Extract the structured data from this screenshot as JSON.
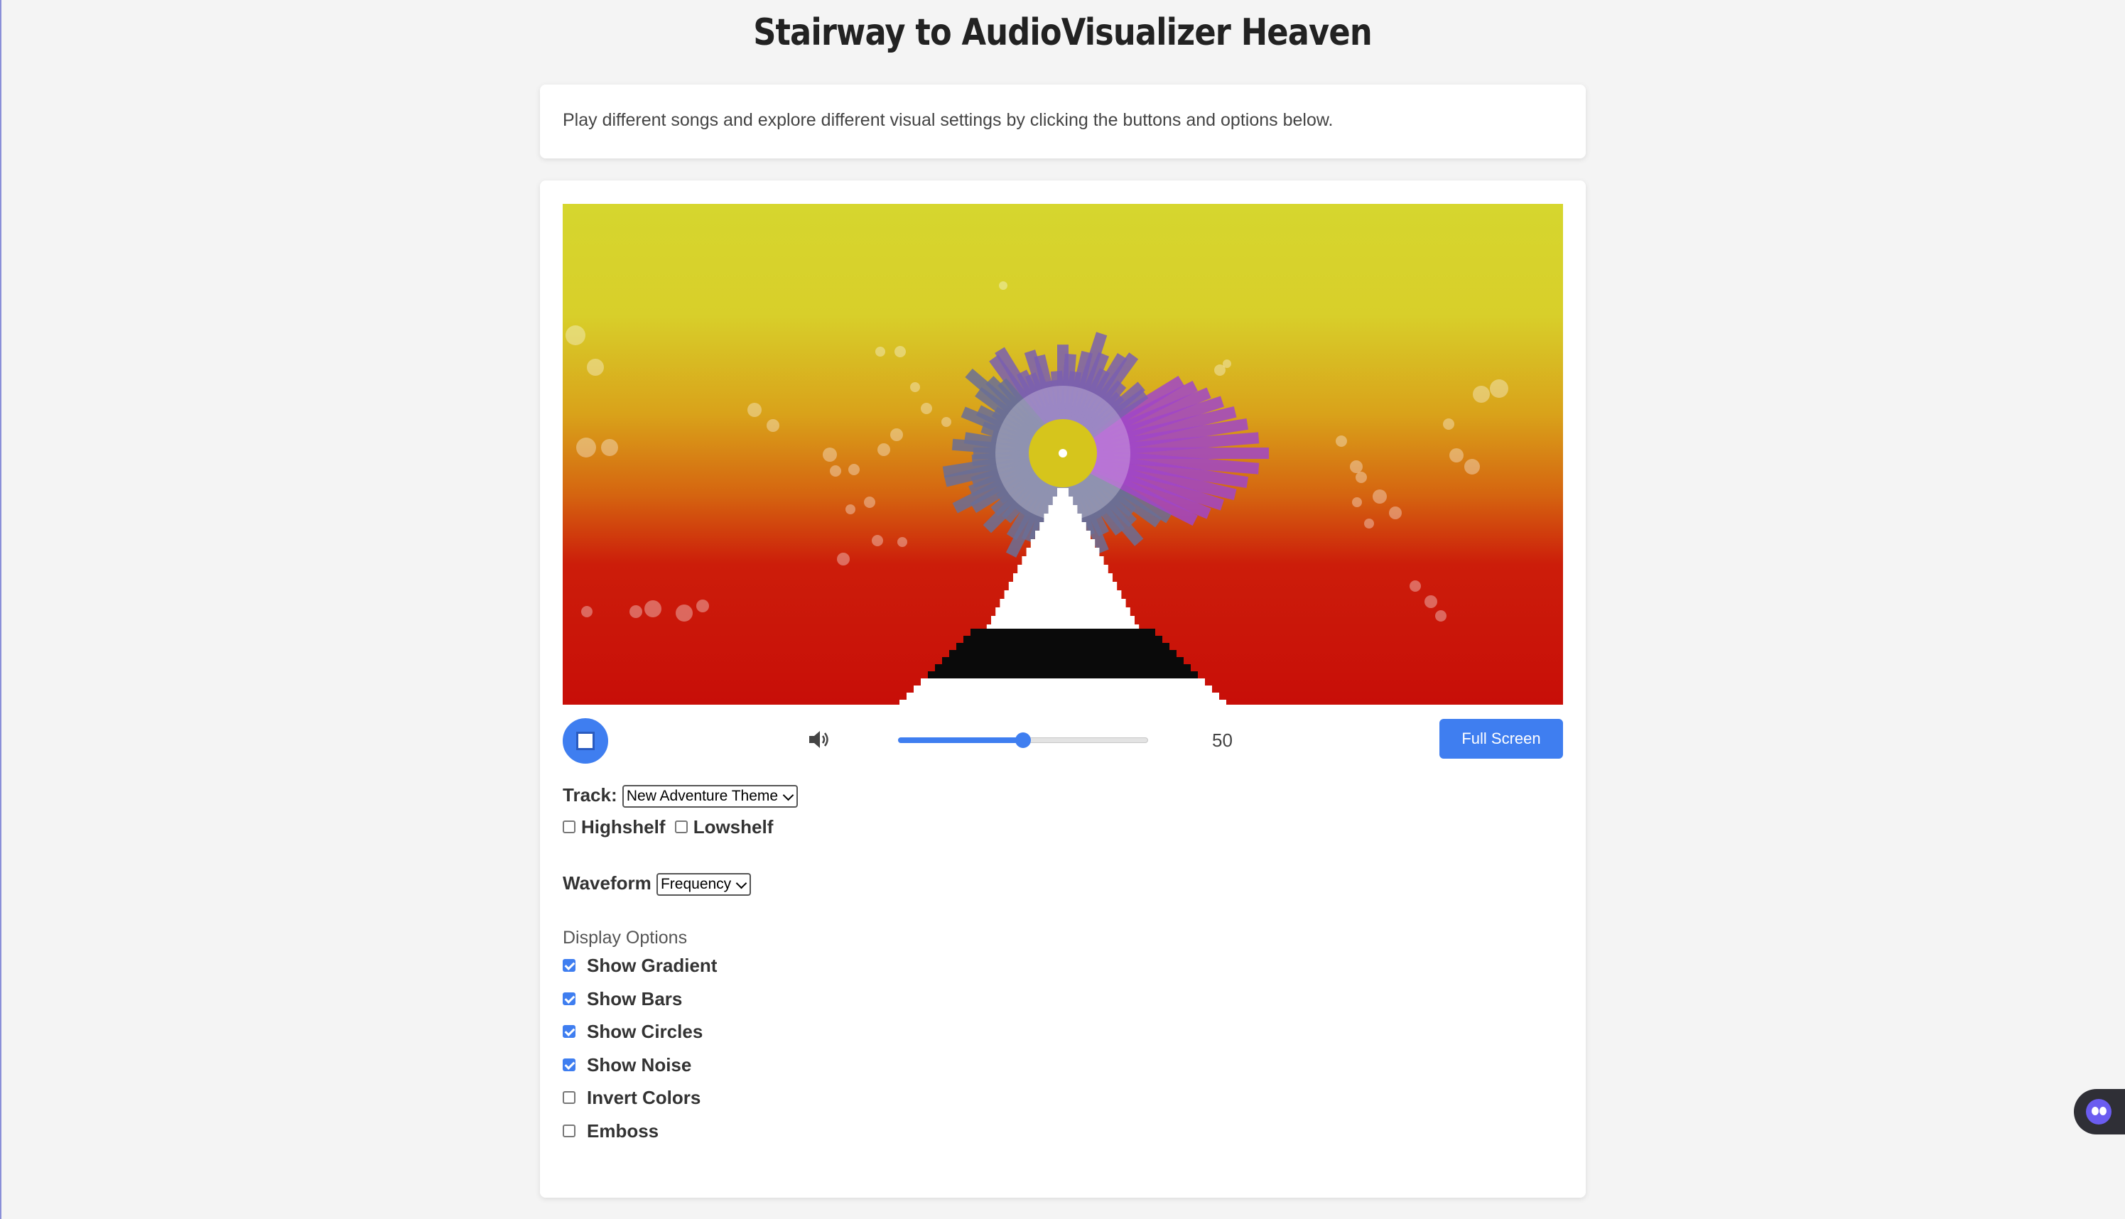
{
  "page": {
    "title": "Stairway to AudioVisualizer Heaven",
    "intro": "Play different songs and explore different visual settings by clicking the buttons and options below."
  },
  "player": {
    "stop_icon": "stop-square-icon",
    "volume_icon": "speaker-volume-icon",
    "volume_level": 50,
    "volume_display": "50",
    "fullscreen_label": "Full Screen"
  },
  "track": {
    "label": "Track:",
    "selected": "New Adventure Theme"
  },
  "filters": {
    "highshelf_label": "Highshelf",
    "highshelf_checked": false,
    "lowshelf_label": "Lowshelf",
    "lowshelf_checked": false
  },
  "waveform": {
    "label": "Waveform",
    "selected": "Frequency"
  },
  "display_options": {
    "heading": "Display Options",
    "items": [
      {
        "label": "Show Gradient",
        "checked": true
      },
      {
        "label": "Show Bars",
        "checked": true
      },
      {
        "label": "Show Circles",
        "checked": true
      },
      {
        "label": "Show Noise",
        "checked": true
      },
      {
        "label": "Invert Colors",
        "checked": false
      },
      {
        "label": "Emboss",
        "checked": false
      }
    ]
  },
  "colors": {
    "accent": "#3f7ef0",
    "gradient_top": "#d6d62e",
    "gradient_bottom": "#c80e08"
  },
  "chat_widget": {
    "icon": "chat-bot-face-icon"
  }
}
